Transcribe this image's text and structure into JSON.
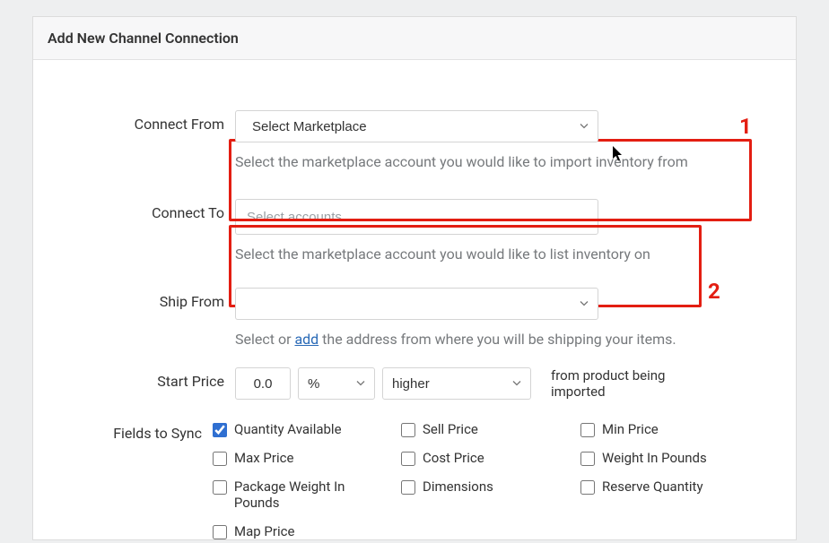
{
  "panel": {
    "title": "Add New Channel Connection"
  },
  "annotations": {
    "one": "1",
    "two": "2"
  },
  "connectFrom": {
    "label": "Connect From",
    "selected": "Select Marketplace",
    "helper": "Select the marketplace account you would like to import inventory from"
  },
  "connectTo": {
    "label": "Connect To",
    "placeholder": "Select accounts",
    "helper": "Select the marketplace account you would like to list inventory on"
  },
  "shipFrom": {
    "label": "Ship From",
    "helperPrefix": "Select or ",
    "helperLink": "add",
    "helperSuffix": " the address from where you will be shipping your items."
  },
  "startPrice": {
    "label": "Start Price",
    "value": "0.0",
    "unit": "%",
    "direction": "higher",
    "sideText": "from product being imported"
  },
  "fieldsToSync": {
    "label": "Fields to Sync",
    "items": [
      {
        "label": "Quantity Available",
        "checked": true
      },
      {
        "label": "Sell Price",
        "checked": false
      },
      {
        "label": "Min Price",
        "checked": false
      },
      {
        "label": "Max Price",
        "checked": false
      },
      {
        "label": "Cost Price",
        "checked": false
      },
      {
        "label": "Weight In Pounds",
        "checked": false
      },
      {
        "label": "Package Weight In Pounds",
        "checked": false
      },
      {
        "label": "Dimensions",
        "checked": false
      },
      {
        "label": "Reserve Quantity",
        "checked": false
      },
      {
        "label": "Map Price",
        "checked": false
      }
    ]
  }
}
